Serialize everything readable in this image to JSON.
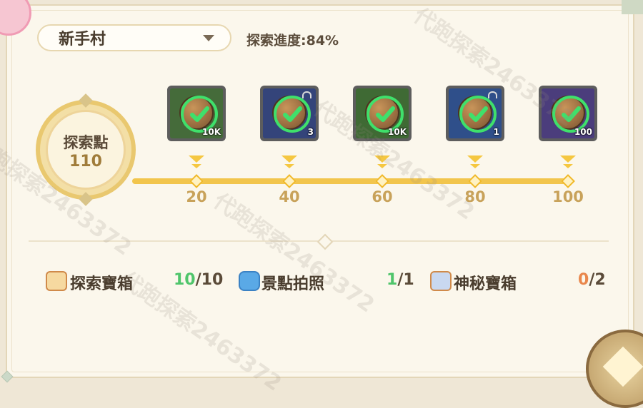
{
  "header": {
    "area_select": "新手村",
    "progress_label": "探索進度:84%"
  },
  "medal": {
    "title": "探索點",
    "value": "110"
  },
  "milestones": [
    {
      "label": "20",
      "reward_qty": "10K",
      "locked": false,
      "color": "#456b3a"
    },
    {
      "label": "40",
      "reward_qty": "3",
      "locked": true,
      "color": "#34447a"
    },
    {
      "label": "60",
      "reward_qty": "10K",
      "locked": false,
      "color": "#3f6a34"
    },
    {
      "label": "80",
      "reward_qty": "1",
      "locked": true,
      "color": "#2f4f8a"
    },
    {
      "label": "100",
      "reward_qty": "100",
      "locked": false,
      "color": "#4b3d7c"
    }
  ],
  "stats": [
    {
      "label": "探索寶箱",
      "current": "10",
      "total": "/10",
      "current_color": "green",
      "icon": "chest-icon"
    },
    {
      "label": "景點拍照",
      "current": "1",
      "total": "/1",
      "current_color": "green",
      "icon": "camera-icon"
    },
    {
      "label": "神秘寶箱",
      "current": "0",
      "total": "/2",
      "current_color": "orange",
      "icon": "mystery-chest-icon"
    }
  ],
  "watermark": "代跑探索2463372"
}
